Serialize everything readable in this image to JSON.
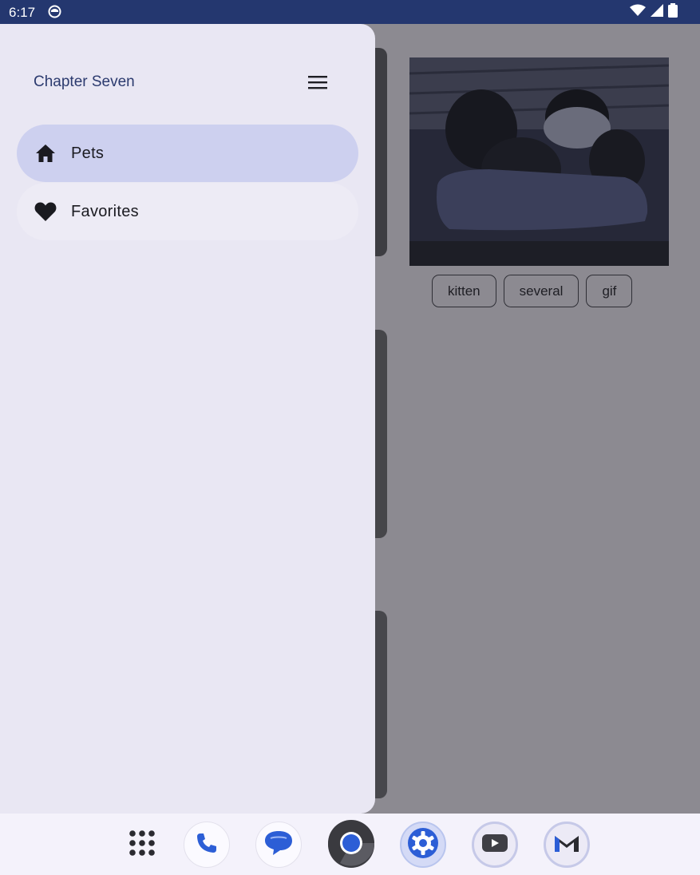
{
  "status_bar": {
    "time": "6:17"
  },
  "drawer": {
    "title": "Chapter Seven",
    "items": [
      {
        "label": "Pets",
        "icon": "home-icon",
        "selected": true
      },
      {
        "label": "Favorites",
        "icon": "heart-icon",
        "selected": false
      }
    ]
  },
  "content": {
    "tags": [
      "kitten",
      "several",
      "gif"
    ]
  },
  "dock": {
    "apps": [
      "app-drawer-icon",
      "phone-icon",
      "messages-icon",
      "chrome-icon",
      "settings-icon",
      "youtube-icon",
      "gmail-icon"
    ]
  },
  "colors": {
    "status_bar": "#24376f",
    "drawer_bg": "#e9e7f3",
    "selected_item": "#cdd0ef",
    "title": "#2b3a6e",
    "scrim": "#8c8a91"
  }
}
